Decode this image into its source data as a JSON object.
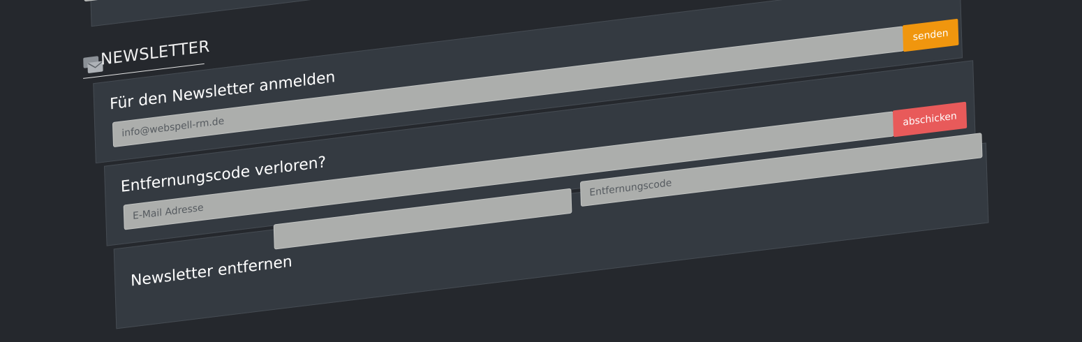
{
  "section": {
    "title": "NEWSLETTER",
    "icon": "newsletter-envelope-icon"
  },
  "top_form": {
    "button_label": "abschicken",
    "button_color": "#5cb85c"
  },
  "subscribe": {
    "title": "Für den Newsletter anmelden",
    "email_placeholder": "info@webspell-rm.de",
    "button_label": "senden",
    "button_color": "#f0960e"
  },
  "lost_code": {
    "title": "Entfernungscode verloren?",
    "email_placeholder": "E-Mail Adresse",
    "button_label": "abschicken",
    "button_color": "#e85a5a"
  },
  "remove": {
    "title": "Newsletter entfernen",
    "code_placeholder": "Entfernungscode"
  }
}
